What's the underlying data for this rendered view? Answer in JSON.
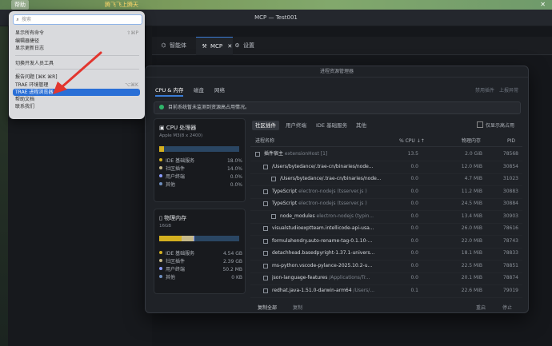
{
  "menubar": {
    "help": "帮助",
    "right_text": "腾飞飞上腾天",
    "close": "✕"
  },
  "window": {
    "title": "MCP — Test001"
  },
  "tabs": [
    {
      "label": "智能体",
      "icon": "robot-icon"
    },
    {
      "label": "MCP",
      "icon": "wrench-icon",
      "close": "✕"
    },
    {
      "label": "设置",
      "icon": "gear-icon"
    }
  ],
  "menu": {
    "search_placeholder": "搜索",
    "items": [
      {
        "label": "显示所有命令",
        "shortcut": "⇧⌘P"
      },
      {
        "label": "编辑器捷径",
        "shortcut": ""
      },
      {
        "label": "显示更新日志",
        "shortcut": ""
      },
      {
        "label": "切换开发人员工具",
        "shortcut": ""
      },
      {
        "label": "报告问题 [⌘K ⌘R]",
        "shortcut": ""
      },
      {
        "label": "TRAE 环境管理",
        "shortcut": "⌥⌘K"
      },
      {
        "label": "TRAE 进程浏览器",
        "shortcut": ""
      },
      {
        "label": "帮助文档",
        "shortcut": ""
      },
      {
        "label": "联系我们",
        "shortcut": ""
      }
    ]
  },
  "panel": {
    "title": "进程资源管理器",
    "tabs": [
      "CPU & 内存",
      "磁盘",
      "网络"
    ],
    "links": [
      "禁用插件",
      "上报异常"
    ],
    "status": "目前系统暂未监测到资源高占用情况。",
    "cpu": {
      "title": "CPU 处理器",
      "icon": "cpu-icon",
      "subtitle": "Apple M3(8 x 2400)",
      "legend": [
        {
          "label": "IDE 基础服务",
          "value": "18.0%",
          "color": "#d4b020",
          "fraction": 0.18
        },
        {
          "label": "社区插件",
          "value": "14.0%",
          "color": "#c6b98a",
          "fraction": 0.14
        },
        {
          "label": "用户终端",
          "value": "0.0%",
          "color": "#8a9cff",
          "fraction": 0
        },
        {
          "label": "其他",
          "value": "0.0%",
          "color": "#6f8fbf",
          "fraction": 0
        }
      ]
    },
    "memory": {
      "title": "物理内存",
      "icon": "memory-icon",
      "subtitle": "16GB",
      "legend": [
        {
          "label": "IDE 基础服务",
          "value": "4.54 GB",
          "color": "#d4b020",
          "fraction": 0.28
        },
        {
          "label": "社区插件",
          "value": "2.39 GB",
          "color": "#c6b98a",
          "fraction": 0.15
        },
        {
          "label": "用户终端",
          "value": "50.2 MB",
          "color": "#8a9cff",
          "fraction": 0.003
        },
        {
          "label": "其他",
          "value": "0 KB",
          "color": "#6f8fbf",
          "fraction": 0
        }
      ]
    },
    "subtabs": [
      "社区插件",
      "用户终端",
      "IDE 基础服务",
      "其他"
    ],
    "checkbox_label": "仅显示高占用",
    "columns": [
      "进程名称",
      "% CPU ↓↑",
      "物理内存",
      "PID"
    ],
    "rows": [
      {
        "name": "插件宿主",
        "extra": " extensionHost [1]",
        "cpu": "13.5",
        "mem": "2.0 GiB",
        "pid": "78568",
        "indent": 0
      },
      {
        "name": "/Users/bytedance/.trae-cn/binaries/node...",
        "extra": "",
        "cpu": "0.0",
        "mem": "12.0 MiB",
        "pid": "30854",
        "indent": 1
      },
      {
        "name": "/Users/bytedance/.trae-cn/binaries/node...",
        "extra": "",
        "cpu": "0.0",
        "mem": "4.7 MiB",
        "pid": "31023",
        "indent": 2
      },
      {
        "name": "TypeScript",
        "extra": " electron-nodejs (tsserver.js )",
        "cpu": "0.0",
        "mem": "11.2 MiB",
        "pid": "30883",
        "indent": 1
      },
      {
        "name": "TypeScript",
        "extra": " electron-nodejs (tsserver.js )",
        "cpu": "0.0",
        "mem": "24.5 MiB",
        "pid": "30884",
        "indent": 1
      },
      {
        "name": "node_modules",
        "extra": " electron-nodejs (typin...",
        "cpu": "0.0",
        "mem": "13.4 MiB",
        "pid": "30903",
        "indent": 2
      },
      {
        "name": "visualstudioexptteam.intellicode-api-usa...",
        "extra": "",
        "cpu": "0.0",
        "mem": "26.0 MiB",
        "pid": "78616",
        "indent": 1
      },
      {
        "name": "formulahendry.auto-rename-tag-0.1.10-...",
        "extra": "",
        "cpu": "0.0",
        "mem": "22.0 MiB",
        "pid": "78743",
        "indent": 1
      },
      {
        "name": "detachhead.basedpyright-1.37.1-univers...",
        "extra": "",
        "cpu": "0.0",
        "mem": "18.1 MiB",
        "pid": "78833",
        "indent": 1
      },
      {
        "name": "ms-python.vscode-pylance-2025.10.2-u...",
        "extra": "",
        "cpu": "0.0",
        "mem": "22.5 MiB",
        "pid": "78851",
        "indent": 1
      },
      {
        "name": "json-language-features",
        "extra": " /Applications/Tr...",
        "cpu": "0.0",
        "mem": "20.1 MiB",
        "pid": "78874",
        "indent": 1
      },
      {
        "name": "redhat.java-1.51.0-darwin-arm64",
        "extra": " /Users/...",
        "cpu": "0.1",
        "mem": "22.6 MiB",
        "pid": "79019",
        "indent": 1
      }
    ],
    "footer": {
      "copy_all": "复制全部",
      "copy": "复制",
      "restart": "重启",
      "stop": "停止"
    }
  }
}
